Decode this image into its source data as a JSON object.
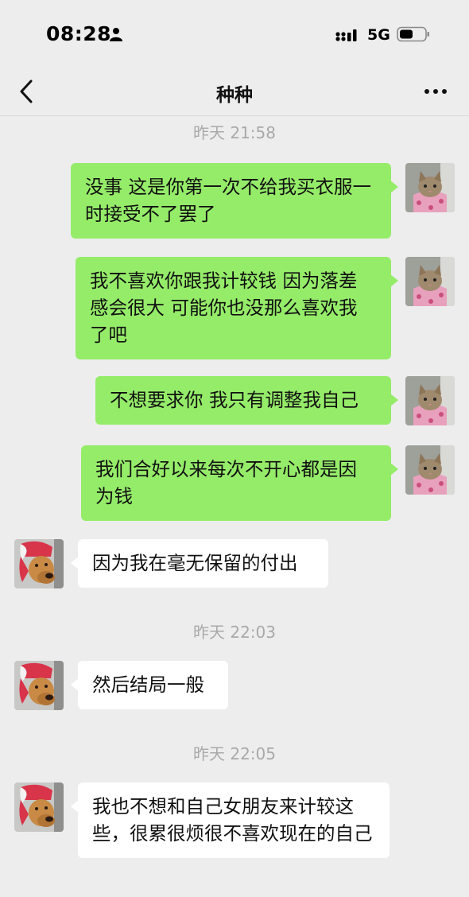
{
  "status_bar": {
    "time": "08:28",
    "network": "5G",
    "icons": [
      "person-icon",
      "signal-icon",
      "battery-icon"
    ]
  },
  "nav": {
    "title": "种种",
    "back_icon": "chevron-left-icon",
    "more_icon": "more-dots-icon"
  },
  "colors": {
    "background": "#ededed",
    "sent_bubble": "#95ec69",
    "received_bubble": "#ffffff",
    "timestamp": "#a9a9a9"
  },
  "chat": {
    "timestamps": [
      "昨天 21:58",
      "昨天 22:03",
      "昨天 22:05"
    ],
    "messages": [
      {
        "side": "right",
        "avatar": "cat-avatar",
        "text": "没事 这是你第一次不给我买衣服一时接受不了罢了"
      },
      {
        "side": "right",
        "avatar": "cat-avatar",
        "text": "我不喜欢你跟我计较钱 因为落差感会很大 可能你也没那么喜欢我了吧"
      },
      {
        "side": "right",
        "avatar": "cat-avatar",
        "text": "不想要求你 我只有调整我自己"
      },
      {
        "side": "right",
        "avatar": "cat-avatar",
        "text": "我们合好以来每次不开心都是因为钱"
      },
      {
        "side": "left",
        "avatar": "dog-avatar",
        "text": "因为我在毫无保留的付出"
      },
      {
        "side": "left",
        "avatar": "dog-avatar",
        "text": "然后结局一般"
      },
      {
        "side": "left",
        "avatar": "dog-avatar",
        "text": "我也不想和自己女朋友来计较这些，很累很烦很不喜欢现在的自己"
      }
    ]
  }
}
